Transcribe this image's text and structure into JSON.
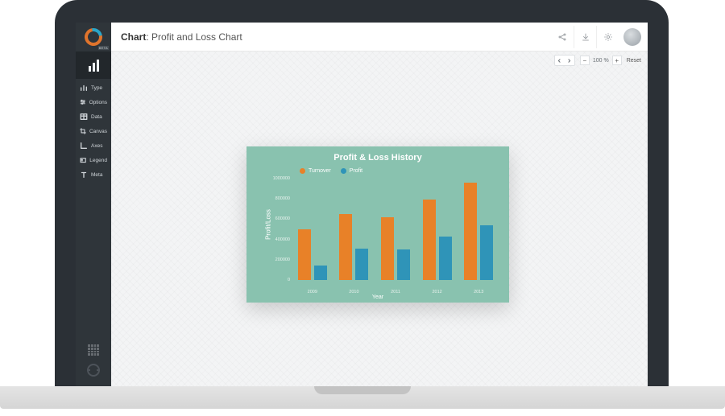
{
  "logo": {
    "badge": "BETA"
  },
  "header": {
    "title_strong": "Chart",
    "title_rest": ": Profit and Loss Chart"
  },
  "sidebar": {
    "items": [
      {
        "icon": "bars-icon",
        "label": "Type"
      },
      {
        "icon": "sliders-icon",
        "label": "Options"
      },
      {
        "icon": "table-icon",
        "label": "Data"
      },
      {
        "icon": "crop-icon",
        "label": "Canvas"
      },
      {
        "icon": "axes-icon",
        "label": "Axes"
      },
      {
        "icon": "legend-icon",
        "label": "Legend"
      },
      {
        "icon": "text-t-icon",
        "label": "Meta"
      }
    ]
  },
  "canvas_toolbar": {
    "zoom_value": "100",
    "zoom_unit": "%",
    "reset_label": "Reset"
  },
  "chart_data": {
    "type": "bar",
    "title": "Profit & Loss History",
    "xlabel": "Year",
    "ylabel": "Profit/Loss",
    "ylim": [
      0,
      1000000
    ],
    "yticks": [
      0,
      200000,
      400000,
      600000,
      800000,
      1000000
    ],
    "categories": [
      "2009",
      "2010",
      "2011",
      "2012",
      "2013"
    ],
    "series": [
      {
        "name": "Turnover",
        "color": "#e88128",
        "values": [
          500000,
          650000,
          620000,
          790000,
          960000
        ]
      },
      {
        "name": "Profit",
        "color": "#2f94b8",
        "values": [
          140000,
          310000,
          300000,
          430000,
          540000
        ]
      }
    ]
  }
}
